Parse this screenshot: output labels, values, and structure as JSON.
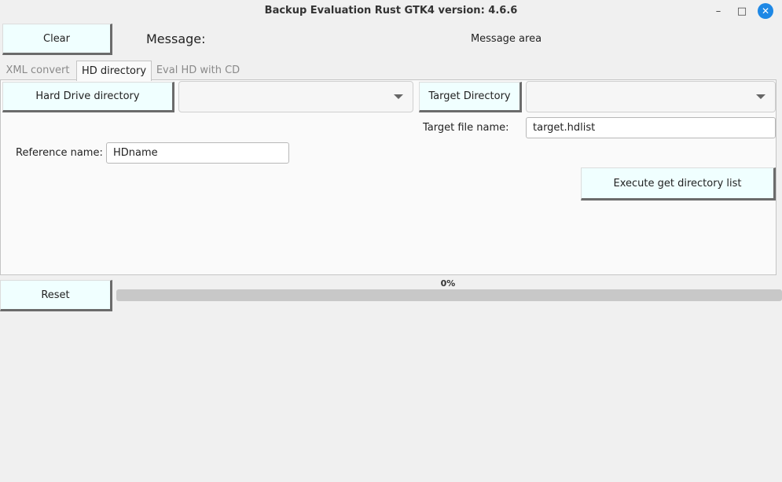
{
  "window": {
    "title": "Backup Evaluation Rust GTK4 version: 4.6.6",
    "minimize_glyph": "–",
    "maximize_glyph": "□",
    "close_glyph": "✕"
  },
  "toolbar": {
    "clear_label": "Clear",
    "message_label": "Message:",
    "message_text": "Message area"
  },
  "tabs": [
    {
      "label": "XML convert",
      "active": false
    },
    {
      "label": "HD directory",
      "active": true
    },
    {
      "label": "Eval HD with CD",
      "active": false
    }
  ],
  "hd_tab": {
    "hd_dir_button": "Hard Drive directory",
    "hd_dir_value": "",
    "target_dir_button": "Target Directory",
    "target_dir_value": "",
    "target_file_label": "Target file name:",
    "target_file_value": "target.hdlist",
    "reference_label": "Reference name:",
    "reference_value": "HDname",
    "execute_button": "Execute get directory list"
  },
  "footer": {
    "reset_label": "Reset",
    "progress_text": "0%",
    "progress_fraction": 0
  },
  "icons": {
    "minimize": "minimize-icon",
    "maximize": "maximize-icon",
    "close": "close-icon",
    "dropdown": "chevron-down-icon"
  },
  "colors": {
    "button_bg": "#f0ffff",
    "close_button": "#1e88e5",
    "progress_track": "#c8c8c8"
  }
}
